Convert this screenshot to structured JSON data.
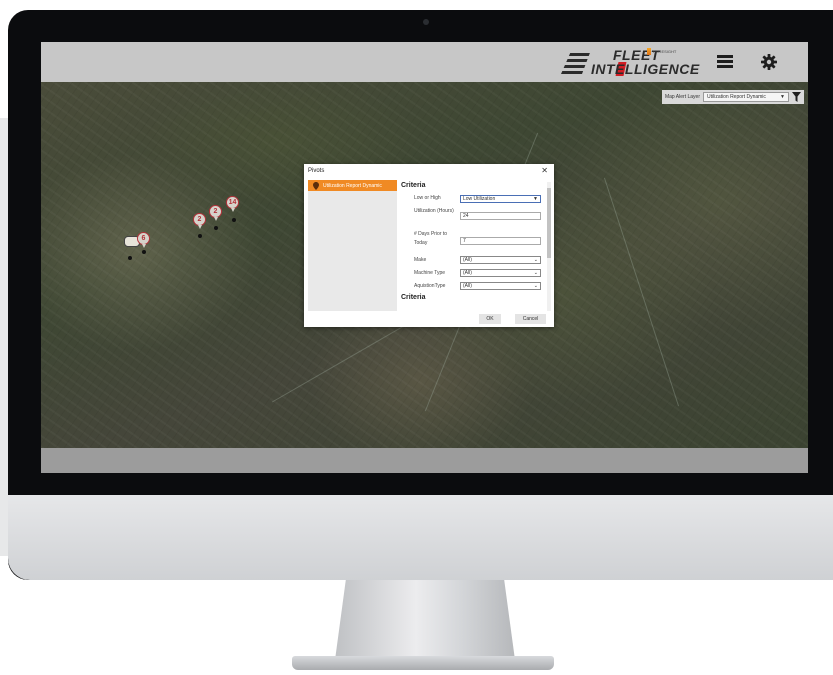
{
  "app": {
    "logo_line1": "FLEET",
    "logo_line2": "INTELLIGENCE",
    "logo_sub": "FORESIGHT",
    "menu_icon": "hamburger-menu-icon",
    "settings_icon": "gear-icon"
  },
  "map": {
    "layer_label": "Map Alert Layer",
    "layer_value": "Utilization Report Dynamic",
    "filter_icon": "filter-icon",
    "clusters": [
      {
        "label": "6"
      },
      {
        "label": "2"
      },
      {
        "label": "2"
      },
      {
        "label": "14"
      }
    ]
  },
  "dialog": {
    "title": "Pivots",
    "close": "✕",
    "pivot_items": [
      {
        "label": "Utilization Report Dynamic"
      }
    ],
    "criteria_heading": "Criteria",
    "criteria_heading_2": "Criteria",
    "fields": {
      "low_or_high": {
        "label": "Low or High",
        "value": "Low Utilization"
      },
      "utilization": {
        "label": "Utilization (Hours)",
        "value": "24"
      },
      "days_prior": {
        "label": "# Days Prior to Today",
        "value": "7"
      },
      "make": {
        "label": "Make",
        "value": "(All)"
      },
      "machine_type": {
        "label": "Machine Type",
        "value": "(All)"
      },
      "aquisition_type": {
        "label": "AquistionType",
        "value": "(All)"
      }
    },
    "ok_label": "OK",
    "cancel_label": "Cancel"
  },
  "colors": {
    "accent_orange": "#f08a24",
    "cluster_red": "#b3323a",
    "topbar_gray": "#c7c7c7"
  }
}
